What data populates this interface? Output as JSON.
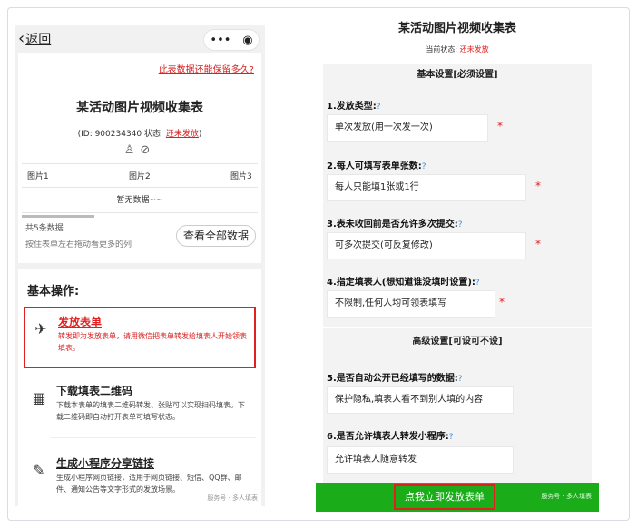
{
  "left": {
    "back_label": "返回",
    "capsule_more": "•••",
    "capsule_close": "◉",
    "keep_link": "此表数据还能保留多久?",
    "title": "某活动图片视频收集表",
    "id_prefix": "(ID: 900234340  状态: ",
    "status": "还未发放",
    "id_suffix": ")",
    "columns": [
      "图片1",
      "图片2",
      "图片3"
    ],
    "empty": "暂无数据~~",
    "count": "共5条数据",
    "hint": "按住表单左右拖动看更多的列",
    "view_all": "查看全部数据",
    "basic_ops": "基本操作:",
    "ops": [
      {
        "name": "发放表单",
        "desc": "转发即为发放表单，请用微信把表单转发给填表人开始领表填表。"
      },
      {
        "name": "下载填表二维码",
        "desc": "下载本表单的填表二维码转发、张贴可以实现扫码填表。下载二维码即自动打开表单可填写状态。"
      },
      {
        "name": "生成小程序分享链接",
        "desc": "生成小程序网页链接，适用于网页链接、短信、QQ群、邮件、通知公告等文字形式的发放场景。"
      }
    ],
    "watermark": "服务号 · 多人填表"
  },
  "right": {
    "title": "某活动图片视频收集表",
    "status_label": "当前状态:",
    "status_value": "还未发放",
    "basic_section": "基本设置[必须设置]",
    "advanced_section": "高级设置[可设可不设]",
    "questions": [
      {
        "label": "1.发放类型:",
        "value": "单次发放(用一次发一次)"
      },
      {
        "label": "2.每人可填写表单张数:",
        "value": "每人只能填1张或1行"
      },
      {
        "label": "3.表未收回前是否允许多次提交:",
        "value": "可多次提交(可反复修改)"
      },
      {
        "label": "4.指定填表人(想知道谁没填时设置):",
        "value": "不限制,任何人均可领表填写"
      },
      {
        "label": "5.是否自动公开已经填写的数据:",
        "value": "保护隐私,填表人看不到别人填的内容"
      },
      {
        "label": "6.是否允许填表人转发小程序:",
        "value": "允许填表人随意转发"
      }
    ],
    "help_icon": "?",
    "required": "*",
    "submit": "点我立即发放表单",
    "watermark": "服务号 · 多人填表"
  },
  "colors": {
    "accent_red": "#e02020",
    "green": "#1aad19",
    "link_blue": "#3a8ee6"
  }
}
